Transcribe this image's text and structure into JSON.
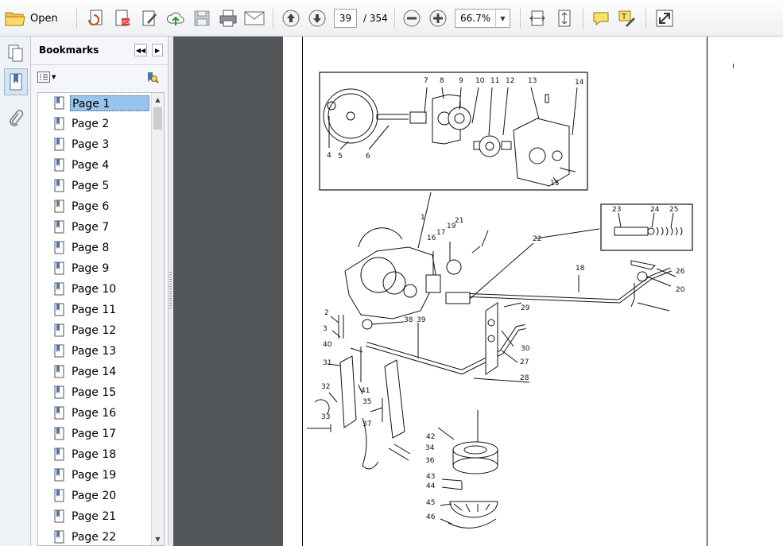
{
  "toolbar": {
    "open_label": "Open",
    "current_page": "39",
    "total_pages": "/ 354",
    "zoom": "66.7%"
  },
  "bookmarks": {
    "title": "Bookmarks",
    "items": [
      {
        "label": "Page 1",
        "selected": true
      },
      {
        "label": "Page 2"
      },
      {
        "label": "Page 3"
      },
      {
        "label": "Page 4"
      },
      {
        "label": "Page 5"
      },
      {
        "label": "Page 6"
      },
      {
        "label": "Page 7"
      },
      {
        "label": "Page 8"
      },
      {
        "label": "Page 9"
      },
      {
        "label": "Page 10"
      },
      {
        "label": "Page 11"
      },
      {
        "label": "Page 12"
      },
      {
        "label": "Page 13"
      },
      {
        "label": "Page 14"
      },
      {
        "label": "Page 15"
      },
      {
        "label": "Page 16"
      },
      {
        "label": "Page 17"
      },
      {
        "label": "Page 18"
      },
      {
        "label": "Page 19"
      },
      {
        "label": "Page 20"
      },
      {
        "label": "Page 21"
      },
      {
        "label": "Page 22"
      }
    ]
  },
  "diagram": {
    "callouts": [
      "1",
      "2",
      "3",
      "4",
      "5",
      "6",
      "7",
      "8",
      "9",
      "10",
      "11",
      "12",
      "13",
      "14",
      "15",
      "16",
      "17",
      "18",
      "19",
      "20",
      "21",
      "22",
      "23",
      "24",
      "25",
      "26",
      "27",
      "28",
      "29",
      "30",
      "31",
      "32",
      "33",
      "34",
      "35",
      "36",
      "37",
      "38",
      "39",
      "40",
      "41",
      "42",
      "43",
      "44",
      "45",
      "46"
    ]
  },
  "colors": {
    "toolbar_bg": "#eef0f3",
    "doc_bg": "#525659",
    "selection": "#99c4ee"
  }
}
